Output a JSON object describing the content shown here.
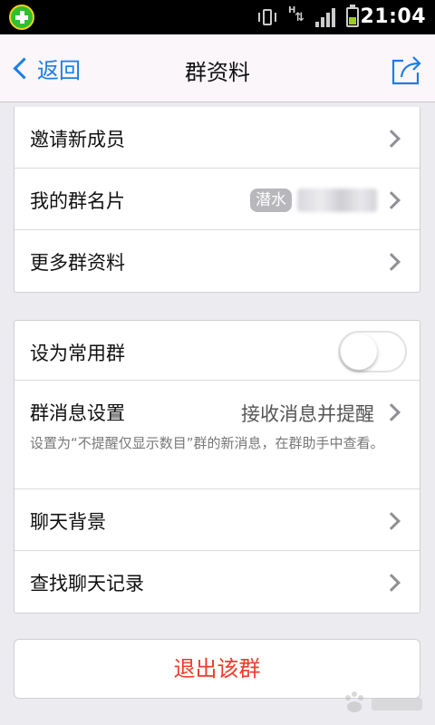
{
  "status_bar": {
    "time": "21:04",
    "battery_level": 0.5,
    "signal_bars": 4
  },
  "nav": {
    "back_label": "返回",
    "title": "群资料"
  },
  "group1": {
    "rows": [
      {
        "label": "邀请新成员"
      },
      {
        "label": "我的群名片",
        "badge": "潜水"
      },
      {
        "label": "更多群资料"
      }
    ]
  },
  "group2": {
    "common_group": {
      "label": "设为常用群",
      "enabled": false
    },
    "message_settings": {
      "label": "群消息设置",
      "value": "接收消息并提醒",
      "hint": "设置为“不提醒仅显示数目”群的新消息，在群助手中查看。"
    },
    "chat_background": {
      "label": "聊天背景"
    },
    "find_history": {
      "label": "查找聊天记录"
    }
  },
  "exit": {
    "label": "退出该群"
  },
  "colors": {
    "accent": "#1a7ee5",
    "danger": "#f23b2c",
    "background": "#ebebf0"
  },
  "icons": [
    "app-logo-icon",
    "vibrate-icon",
    "data-transfer-icon",
    "signal-icon",
    "battery-icon",
    "back-chevron-icon",
    "share-icon",
    "chevron-right-icon"
  ]
}
